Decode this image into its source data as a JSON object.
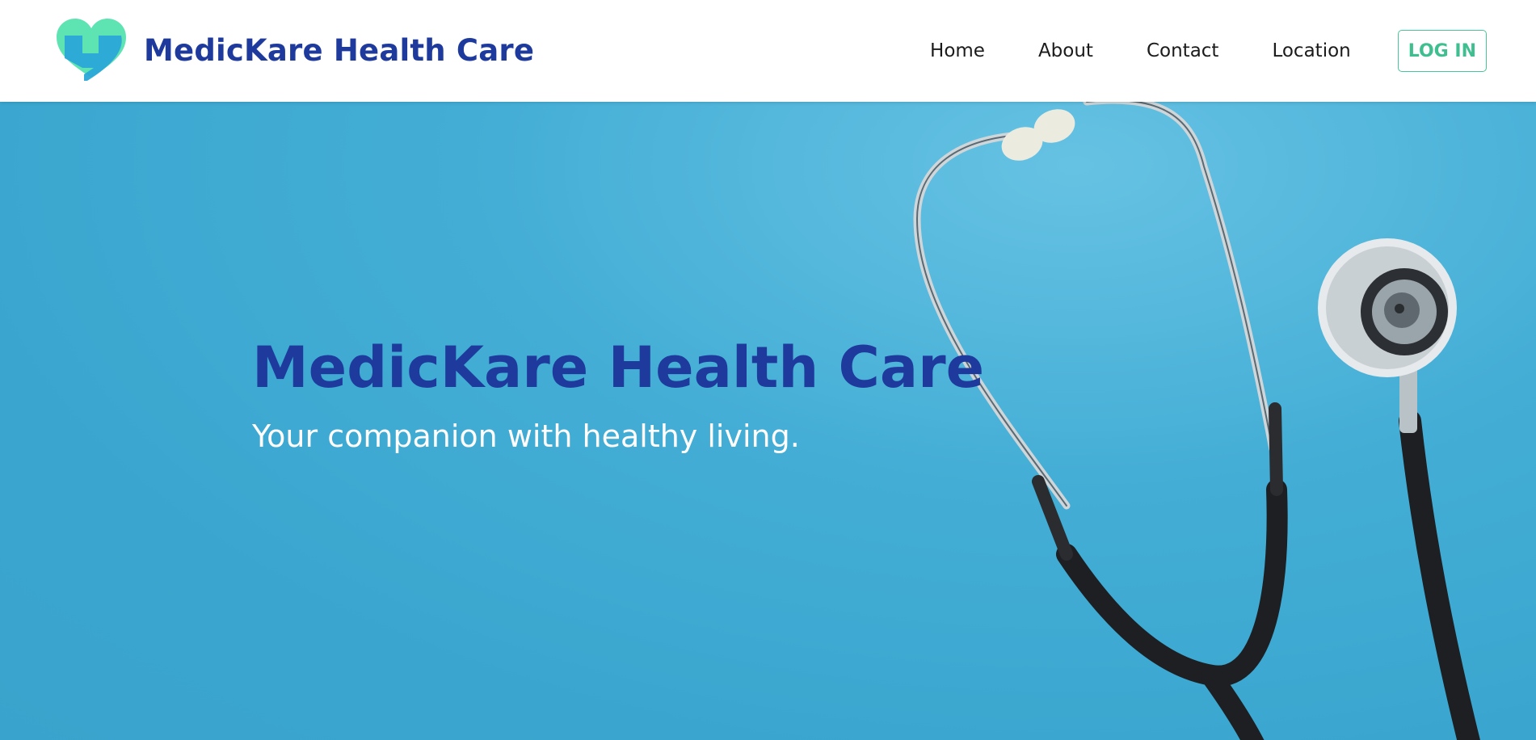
{
  "brand": {
    "name": "MedicKare Health Care",
    "logo_icon": "heart-logo-icon",
    "colors": {
      "heart_outer": "#5ee3b3",
      "heart_inner": "#2aa8d8",
      "text": "#1e3a9c"
    }
  },
  "nav": {
    "items": [
      {
        "label": "Home"
      },
      {
        "label": "About"
      },
      {
        "label": "Contact"
      },
      {
        "label": "Location"
      }
    ],
    "login_label": "LOG IN"
  },
  "hero": {
    "title": "MedicKare Health Care",
    "subtitle": "Your companion with healthy living.",
    "background_image": "stethoscope-on-blue-background",
    "colors": {
      "background": "#3ea8d1",
      "title": "#1e3a9c",
      "subtitle": "#ffffff"
    }
  }
}
